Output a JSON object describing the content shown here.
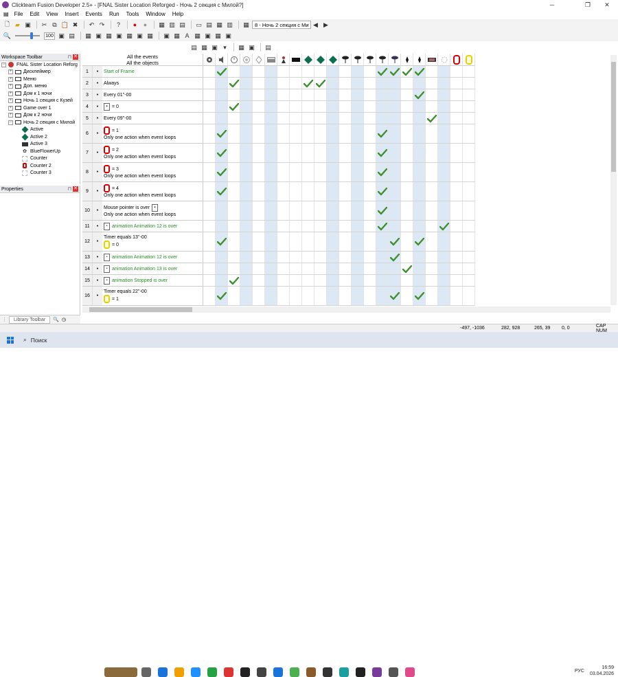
{
  "window": {
    "title": "Clickteam Fusion Developer 2.5+ - [FNAL Sister Location Reforged - Ночь 2 секция с Милой?]",
    "controls": [
      "─",
      "❐",
      "✕"
    ]
  },
  "menu": [
    "File",
    "Edit",
    "View",
    "Insert",
    "Events",
    "Run",
    "Tools",
    "Window",
    "Help"
  ],
  "toolbar": {
    "frame_selector": "8 - Ночь 2 секция с Ми",
    "zoom": "100"
  },
  "workspace": {
    "title": "Workspace Toolbar",
    "items": [
      {
        "label": "FNAL Sister Location Reforg",
        "indent": 0,
        "pm": "−",
        "icon": "app-icon"
      },
      {
        "label": "Дисклеймер",
        "indent": 1,
        "pm": "+",
        "icon": "frame-icon"
      },
      {
        "label": "Меню",
        "indent": 1,
        "pm": "+",
        "icon": "frame-icon"
      },
      {
        "label": "Доп. меню",
        "indent": 1,
        "pm": "+",
        "icon": "frame-icon"
      },
      {
        "label": "Дом к 1 ночи",
        "indent": 1,
        "pm": "+",
        "icon": "frame-icon"
      },
      {
        "label": "Ночь 1 секция с Кузей",
        "indent": 1,
        "pm": "+",
        "icon": "frame-icon"
      },
      {
        "label": "Game over 1",
        "indent": 1,
        "pm": "+",
        "icon": "frame-icon"
      },
      {
        "label": "Дом к 2 ночи",
        "indent": 1,
        "pm": "+",
        "icon": "frame-icon"
      },
      {
        "label": "Ночь 2 секция с Милой",
        "indent": 1,
        "pm": "−",
        "icon": "frame-icon"
      },
      {
        "label": "Active",
        "indent": 2,
        "pm": "",
        "icon": "active-icon"
      },
      {
        "label": "Active 2",
        "indent": 2,
        "pm": "",
        "icon": "active-icon"
      },
      {
        "label": "Active 3",
        "indent": 2,
        "pm": "",
        "icon": "sprite-icon"
      },
      {
        "label": "BlueFlowerUp",
        "indent": 2,
        "pm": "",
        "icon": "flower-icon"
      },
      {
        "label": "Counter",
        "indent": 2,
        "pm": "",
        "icon": "blank-icon"
      },
      {
        "label": "Counter 2",
        "indent": 2,
        "pm": "",
        "icon": "counter-red-icon"
      },
      {
        "label": "Counter 3",
        "indent": 2,
        "pm": "",
        "icon": "blank-icon"
      }
    ]
  },
  "properties": {
    "title": "Properties"
  },
  "library": {
    "tab": "Library Toolbar"
  },
  "editor": {
    "header_line1": "All the events",
    "header_line2": "All the objects",
    "events": [
      {
        "num": "1",
        "lines": [
          {
            "text": "Start of Frame",
            "green": true
          }
        ],
        "checks": [
          1,
          14,
          15,
          16,
          17
        ]
      },
      {
        "num": "2",
        "lines": [
          {
            "text": "Always",
            "green": false
          }
        ],
        "checks": [
          2,
          8,
          9
        ]
      },
      {
        "num": "3",
        "lines": [
          {
            "text": "Every 01''-00",
            "green": false
          }
        ],
        "checks": [
          17
        ]
      },
      {
        "num": "4",
        "lines": [
          {
            "text": "= 0",
            "green": false,
            "icon": "box"
          }
        ],
        "checks": [
          2
        ]
      },
      {
        "num": "5",
        "lines": [
          {
            "text": "Every 09''-00",
            "green": false
          }
        ],
        "checks": [
          18
        ]
      },
      {
        "num": "6",
        "lines": [
          {
            "text": "= 1",
            "green": false,
            "icon": "red"
          },
          {
            "text": "Only one action when event loops",
            "green": false
          }
        ],
        "checks": [
          1,
          14
        ]
      },
      {
        "num": "7",
        "lines": [
          {
            "text": "= 2",
            "green": false,
            "icon": "red"
          },
          {
            "text": "Only one action when event loops",
            "green": false
          }
        ],
        "checks": [
          1,
          14
        ]
      },
      {
        "num": "8",
        "lines": [
          {
            "text": "= 3",
            "green": false,
            "icon": "red"
          },
          {
            "text": "Only one action when event loops",
            "green": false
          }
        ],
        "checks": [
          1,
          14
        ]
      },
      {
        "num": "9",
        "lines": [
          {
            "text": "= 4",
            "green": false,
            "icon": "red"
          },
          {
            "text": "Only one action when event loops",
            "green": false
          }
        ],
        "checks": [
          1,
          14
        ]
      },
      {
        "num": "10",
        "lines": [
          {
            "text": "Mouse pointer is over",
            "green": false,
            "icon_after": "box"
          },
          {
            "text": "Only one action when event loops",
            "green": false
          }
        ],
        "checks": [
          14
        ]
      },
      {
        "num": "11",
        "lines": [
          {
            "text": "animation Animation 12 is over",
            "green": true,
            "icon": "box"
          }
        ],
        "checks": [
          14,
          19
        ]
      },
      {
        "num": "12",
        "lines": [
          {
            "text": "Timer equals 13''-00",
            "green": false
          },
          {
            "text": "= 0",
            "green": false,
            "icon": "yellow"
          }
        ],
        "checks": [
          1,
          15,
          17
        ]
      },
      {
        "num": "13",
        "lines": [
          {
            "text": "animation Animation 12 is over",
            "green": true,
            "icon": "box"
          }
        ],
        "checks": [
          15
        ]
      },
      {
        "num": "14",
        "lines": [
          {
            "text": "animation Animation 13 is over",
            "green": true,
            "icon": "box"
          }
        ],
        "checks": [
          16
        ]
      },
      {
        "num": "15",
        "lines": [
          {
            "text": "animation Stopped is over",
            "green": true,
            "icon": "box"
          }
        ],
        "checks": [
          2
        ]
      },
      {
        "num": "16",
        "lines": [
          {
            "text": "Timer equals 22''-00",
            "green": false
          },
          {
            "text": "= 1",
            "green": false,
            "icon": "yellow"
          }
        ],
        "checks": [
          1,
          15,
          17
        ]
      }
    ],
    "object_columns": [
      "system-gear-icon",
      "speaker-icon",
      "timer-icon",
      "keyboard-icon",
      "mouse-icon",
      "player-icon",
      "piano-keys-icon",
      "person-icon",
      "black-square-icon",
      "green-diamond-icon",
      "green-diamond-icon",
      "black-tree-icon",
      "black-tree-icon",
      "black-tree-icon",
      "black-tree-icon",
      "blue-tree-icon",
      "black-pin-icon",
      "black-pin-icon",
      "sprite-icon",
      "blank-icon",
      "red-counter-icon",
      "yellow-counter-icon"
    ]
  },
  "status": {
    "coords1": "-497, -1036",
    "coords2": "282, 928",
    "coords3": "265, 39",
    "coords4": "0, 0",
    "caps": "CAP NUM"
  },
  "taskbar": {
    "search": "Поиск",
    "lang": "РУС",
    "time": "16:59",
    "date": "03.04.2026"
  }
}
